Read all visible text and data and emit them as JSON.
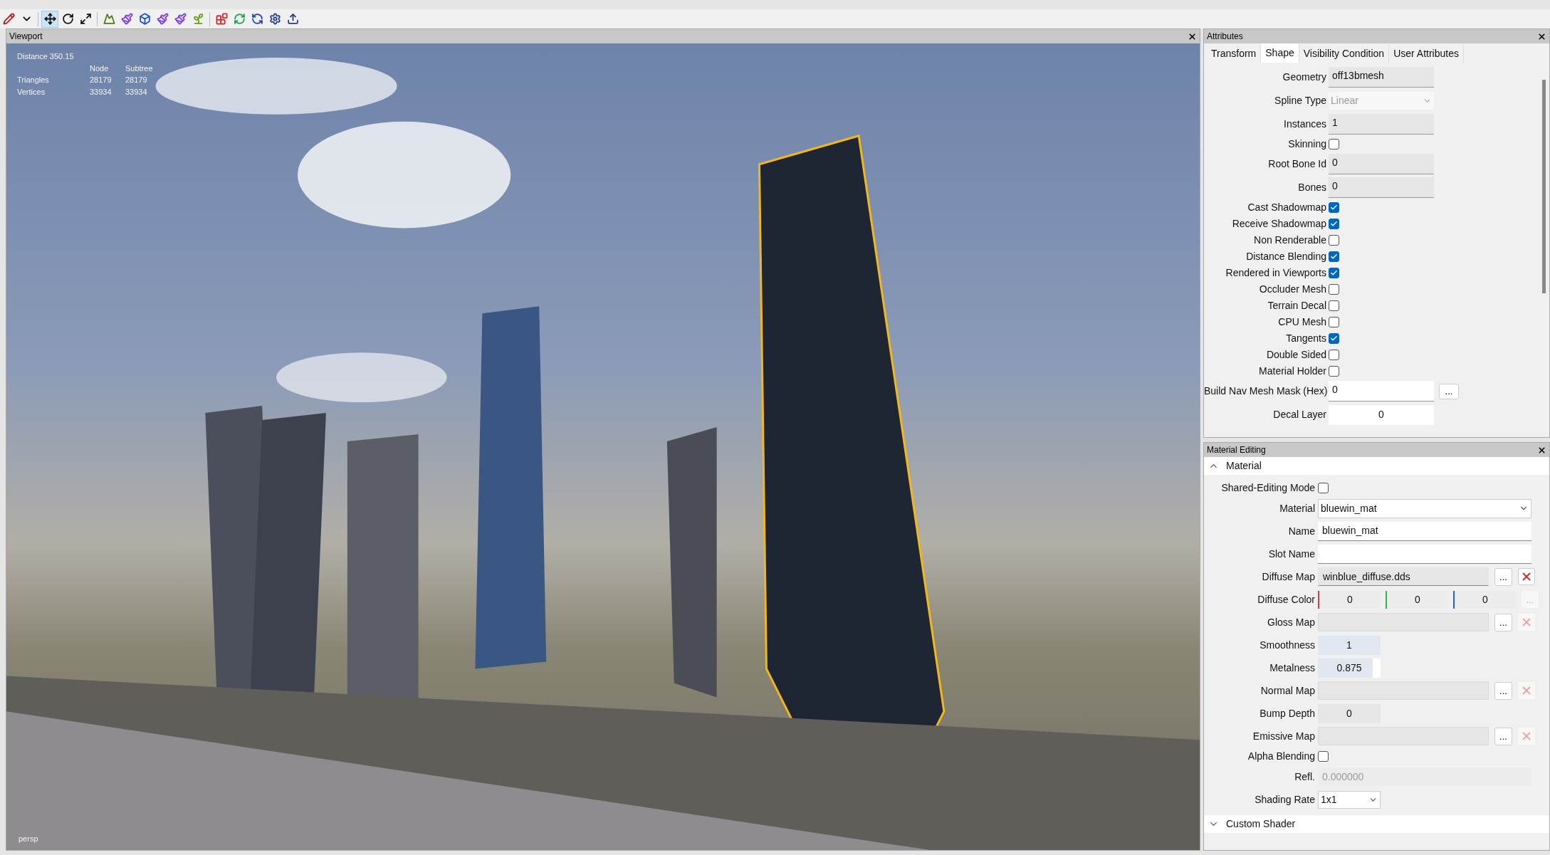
{
  "toolbar": {
    "tools": [
      {
        "kind": "brush",
        "selected": false
      },
      {
        "kind": "dropdown",
        "selected": false
      },
      {
        "kind": "move",
        "selected": true
      },
      {
        "kind": "rotate",
        "selected": false
      },
      {
        "kind": "scale",
        "selected": false
      },
      {
        "kind": "terrain",
        "selected": false
      },
      {
        "kind": "paint",
        "selected": false
      },
      {
        "kind": "cube",
        "selected": false
      },
      {
        "kind": "paint",
        "selected": false
      },
      {
        "kind": "paint",
        "selected": false
      },
      {
        "kind": "plant",
        "selected": false
      },
      {
        "kind": "blocks",
        "selected": false
      },
      {
        "kind": "refresh",
        "selected": false
      },
      {
        "kind": "sync",
        "selected": false
      },
      {
        "kind": "gear",
        "selected": false
      },
      {
        "kind": "export",
        "selected": false
      }
    ]
  },
  "viewport": {
    "title": "Viewport",
    "distance": "Distance 350.15",
    "stats_columns": [
      "Node",
      "Subtree"
    ],
    "stats": [
      {
        "label": "Triangles",
        "node": "28179",
        "subtree": "28179"
      },
      {
        "label": "Vertices",
        "node": "33934",
        "subtree": "33934"
      }
    ],
    "camera": "persp"
  },
  "attributes": {
    "title": "Attributes",
    "tabs": [
      {
        "label": "Transform",
        "selected": false
      },
      {
        "label": "Shape",
        "selected": true
      },
      {
        "label": "Visibility Condition",
        "selected": false
      },
      {
        "label": "User Attributes",
        "selected": false
      }
    ],
    "rows": [
      {
        "kind": "field",
        "label": "Geometry",
        "value": "off13bmesh",
        "readonly": true
      },
      {
        "kind": "select",
        "label": "Spline Type",
        "value": "Linear",
        "disabled": true
      },
      {
        "kind": "field",
        "label": "Instances",
        "value": "1",
        "readonly": true
      },
      {
        "kind": "checkbox",
        "label": "Skinning",
        "checked": false
      },
      {
        "kind": "field",
        "label": "Root Bone Id",
        "value": "0",
        "readonly": true
      },
      {
        "kind": "field",
        "label": "Bones",
        "value": "0",
        "readonly": true
      },
      {
        "kind": "checkbox",
        "label": "Cast Shadowmap",
        "checked": true
      },
      {
        "kind": "checkbox",
        "label": "Receive Shadowmap",
        "checked": true
      },
      {
        "kind": "checkbox",
        "label": "Non Renderable",
        "checked": false
      },
      {
        "kind": "checkbox",
        "label": "Distance Blending",
        "checked": true
      },
      {
        "kind": "checkbox",
        "label": "Rendered in Viewports",
        "checked": true
      },
      {
        "kind": "checkbox",
        "label": "Occluder Mesh",
        "checked": false
      },
      {
        "kind": "checkbox",
        "label": "Terrain Decal",
        "checked": false
      },
      {
        "kind": "checkbox",
        "label": "CPU Mesh",
        "checked": false
      },
      {
        "kind": "checkbox",
        "label": "Tangents",
        "checked": true
      },
      {
        "kind": "checkbox",
        "label": "Double Sided",
        "checked": false
      },
      {
        "kind": "checkbox",
        "label": "Material Holder",
        "checked": false
      },
      {
        "kind": "field_button",
        "label": "Build Nav Mesh Mask (Hex)",
        "value": "0",
        "button": "...",
        "readonly": false
      },
      {
        "kind": "number",
        "label": "Decal Layer",
        "value": "0"
      }
    ]
  },
  "material_editing": {
    "title": "Material Editing",
    "sections": [
      {
        "title": "Material",
        "expanded": true
      },
      {
        "title": "Custom Shader",
        "expanded": false
      }
    ],
    "rows": [
      {
        "kind": "checkbox",
        "label": "Shared-Editing Mode",
        "checked": false
      },
      {
        "kind": "select",
        "label": "Material",
        "value": "bluewin_mat"
      },
      {
        "kind": "field",
        "label": "Name",
        "value": "bluewin_mat"
      },
      {
        "kind": "field",
        "label": "Slot Name"
      },
      {
        "kind": "map",
        "label": "Diffuse Map",
        "value": "winblue_diffuse.dds",
        "button": "...",
        "clearable": true
      },
      {
        "kind": "color",
        "label": "Diffuse Color",
        "values": [
          "0",
          "0",
          "0"
        ],
        "button": "..."
      },
      {
        "kind": "map",
        "label": "Gloss Map",
        "button": "...",
        "clearable": false
      },
      {
        "kind": "spin",
        "label": "Smoothness",
        "value": "1",
        "level": 1
      },
      {
        "kind": "spin",
        "label": "Metalness",
        "value": "0.875",
        "level": 0.875
      },
      {
        "kind": "map",
        "label": "Normal Map",
        "button": "...",
        "clearable": false
      },
      {
        "kind": "number",
        "label": "Bump Depth",
        "value": "0"
      },
      {
        "kind": "map",
        "label": "Emissive Map",
        "button": "...",
        "clearable": false
      },
      {
        "kind": "checkbox",
        "label": "Alpha Blending",
        "checked": false
      },
      {
        "kind": "disabled_field",
        "label": "Refl.",
        "value": "0.000000"
      },
      {
        "kind": "small_select",
        "label": "Shading Rate",
        "value": "1x1"
      }
    ]
  }
}
